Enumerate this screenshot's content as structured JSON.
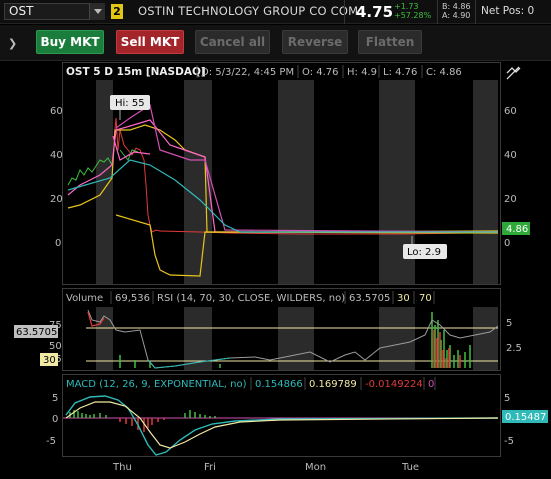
{
  "header": {
    "symbol": "OST",
    "link_group": "2",
    "company": "OSTIN TECHNOLOGY GROUP CO COM",
    "last": "4.75",
    "change": "+1.73",
    "change_pct": "+57.28%",
    "bid": "B: 4.86",
    "ask": "A: 4.90",
    "net_pos": "Net Pos: 0"
  },
  "toolbar": {
    "buy_label": "Buy MKT",
    "sell_label": "Sell MKT",
    "cancel_label": "Cancel all",
    "reverse_label": "Reverse",
    "flatten_label": "Flatten"
  },
  "chart": {
    "symbol_title": "OST 5 D 15m [NASDAQ]",
    "date": "D: 5/3/22, 4:45 PM",
    "open": "O: 4.76",
    "high": "H: 4.9",
    "low": "L: 4.76",
    "close": "C: 4.86",
    "hi_label": "Hi: 55",
    "lo_label": "Lo: 2.9",
    "current_price": "4.86",
    "price_ticks": [
      "60",
      "40",
      "20",
      "0"
    ],
    "volume_title": "Volume",
    "volume_value": "69,536",
    "rsi_title": "RSI (14, 70, 30, CLOSE, WILDERS, no)",
    "rsi_value": "63.5705",
    "rsi_ob": "30",
    "rsi_os": "70",
    "rsi_flag": "63.5705",
    "rsi_flag_30": "30",
    "vol_ticks_left": [
      "75",
      "50",
      "25"
    ],
    "vol_ticks_right": [
      "5",
      "2.5"
    ],
    "macd_title": "MACD (12, 26, 9, EXPONENTIAL, no)",
    "macd_value": "0.154866",
    "macd_avg": "0.169789",
    "macd_diff": "-0.0149224",
    "macd_zero": "0",
    "macd_flag": "0.15487",
    "macd_ticks": [
      "5",
      "0",
      "-5"
    ],
    "x_labels": [
      "Thu",
      "Fri",
      "Mon",
      "Tue"
    ]
  },
  "colors": {
    "buy": "#1a7d3b",
    "sell": "#a3252a",
    "up": "#3fbf3f",
    "down": "#e03a3a",
    "price_flag": "#2fa83a"
  },
  "icons": {
    "expander": "chevron-right-icon",
    "style": "chart-style-icon"
  }
}
